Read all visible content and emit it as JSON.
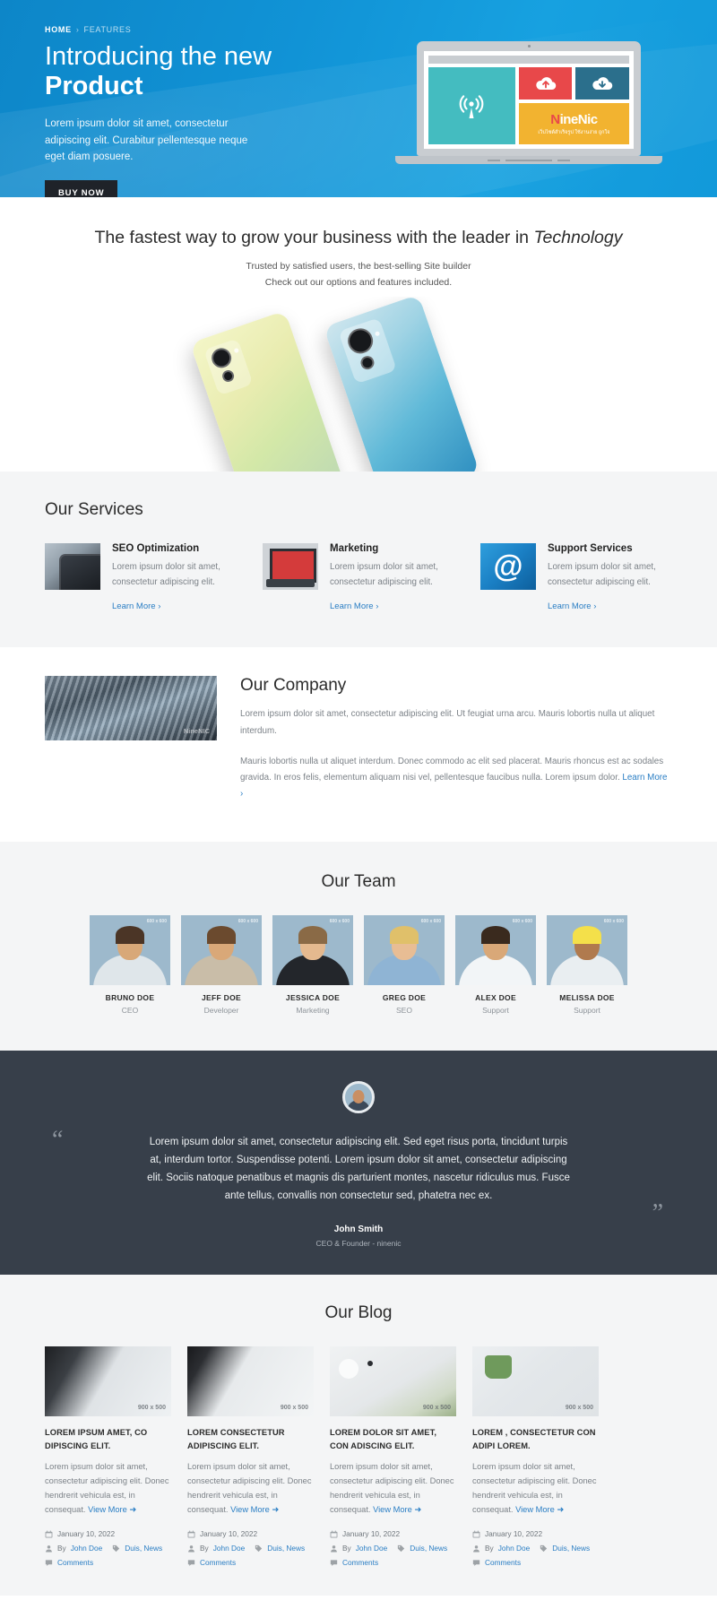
{
  "hero": {
    "breadcrumb": {
      "home": "HOME",
      "separator": "›",
      "current": "FEATURES"
    },
    "title_line1": "Introducing the new",
    "title_line2": "Product",
    "lead": "Lorem ipsum dolor sit amet, consectetur adipiscing elit. Curabitur pellentesque neque eget diam posuere.",
    "cta_label": "BUY NOW",
    "laptop": {
      "logo_prefix": "N",
      "logo_rest": "ineNic",
      "tagline": "เว็บไซต์สำเร็จรูป ใช้งานง่าย ถูกใจ",
      "wifi_icon": "broadcast-icon",
      "upload_icon": "cloud-upload-icon",
      "download_icon": "cloud-download-icon"
    },
    "colors": {
      "bg_start": "#0d86c8",
      "bg_end": "#1299da",
      "cta_bg": "#1f2329"
    }
  },
  "feature": {
    "heading_plain": "The fastest way to grow your business with the leader in ",
    "heading_em": "Technology",
    "sub_line1": "Trusted by satisfied users, the best-selling Site builder",
    "sub_line2": "Check out our options and features included."
  },
  "services": {
    "title": "Our Services",
    "items": [
      {
        "name": "SEO Optimization",
        "desc": "Lorem ipsum dolor sit amet, consectetur adipiscing elit.",
        "link": "Learn More ›",
        "thumb": "smartphone-apps-image"
      },
      {
        "name": "Marketing",
        "desc": "Lorem ipsum dolor sit amet, consectetur adipiscing elit.",
        "link": "Learn More ›",
        "thumb": "laptop-chart-image"
      },
      {
        "name": "Support Services",
        "desc": "Lorem ipsum dolor sit amet, consectetur adipiscing elit.",
        "link": "Learn More ›",
        "thumb": "at-sign-image"
      }
    ]
  },
  "company": {
    "title": "Our Company",
    "image_watermark": "NineNIC",
    "paragraph1": "Lorem ipsum dolor sit amet, consectetur adipiscing elit. Ut feugiat urna arcu. Mauris lobortis nulla ut aliquet interdum.",
    "paragraph2": "Mauris lobortis nulla ut aliquet interdum. Donec commodo ac elit sed placerat. Mauris rhoncus est ac sodales gravida. In eros felis, elementum aliquam nisi vel, pellentesque faucibus nulla. Lorem ipsum dolor. ",
    "link": "Learn More ›"
  },
  "team": {
    "title": "Our Team",
    "members": [
      {
        "name": "BRUNO DOE",
        "role": "CEO",
        "skin": "#d8a878",
        "hair": "#4b3526",
        "body": "#dfe6ea",
        "tag": "600 x 600"
      },
      {
        "name": "JEFF DOE",
        "role": "Developer",
        "skin": "#d9a878",
        "hair": "#6b4a2e",
        "body": "#c9bda8",
        "tag": "600 x 600"
      },
      {
        "name": "JESSICA DOE",
        "role": "Marketing",
        "skin": "#e4b98f",
        "hair": "#8a6a46",
        "body": "#23262b",
        "tag": "600 x 600"
      },
      {
        "name": "GREG DOE",
        "role": "SEO",
        "skin": "#e8bd94",
        "hair": "#e0c06a",
        "body": "#8fb4d4",
        "tag": "600 x 600"
      },
      {
        "name": "ALEX DOE",
        "role": "Support",
        "skin": "#d9a878",
        "hair": "#3a2a1e",
        "body": "#f2f5f7",
        "tag": "600 x 600"
      },
      {
        "name": "MELISSA DOE",
        "role": "Support",
        "skin": "#b07a4e",
        "hair": "#2a1c14",
        "body": "#f4e04a",
        "tag": "600 x 600"
      }
    ]
  },
  "testimonial": {
    "quote": "Lorem ipsum dolor sit amet, consectetur adipiscing elit. Sed eget risus porta, tincidunt turpis at, interdum tortor. Suspendisse potenti. Lorem ipsum dolor sit amet, consectetur adipiscing elit. Sociis natoque penatibus et magnis dis parturient montes, nascetur ridiculus mus. Fusce ante tellus, convallis non consectetur sed, phatetra nec ex.",
    "quote_open": "“",
    "quote_close": "”",
    "author": "John Smith",
    "author_role": "CEO & Founder - ninenic"
  },
  "blog": {
    "title": "Our Blog",
    "posts": [
      {
        "title": "LOREM IPSUM AMET, CO DIPISCING ELIT.",
        "excerpt": "Lorem ipsum dolor sit amet, consectetur adipiscing elit. Donec hendrerit vehicula est, in consequat. ",
        "read_more": "View More ➜",
        "date": "January 10, 2022",
        "author_prefix": "By ",
        "author": "John Doe",
        "tags": "Duis, News",
        "comments": "Comments",
        "image_dims": "900 x 500"
      },
      {
        "title": "LOREM CONSECTETUR ADIPISCING ELIT.",
        "excerpt": "Lorem ipsum dolor sit amet, consectetur adipiscing elit. Donec hendrerit vehicula est, in consequat. ",
        "read_more": "View More ➜",
        "date": "January 10, 2022",
        "author_prefix": "By ",
        "author": "John Doe",
        "tags": "Duis, News",
        "comments": "Comments",
        "image_dims": "900 x 500"
      },
      {
        "title": "LOREM DOLOR SIT AMET, CON ADISCING ELIT.",
        "excerpt": "Lorem ipsum dolor sit amet, consectetur adipiscing elit. Donec hendrerit vehicula est, in consequat. ",
        "read_more": "View More ➜",
        "date": "January 10, 2022",
        "author_prefix": "By ",
        "author": "John Doe",
        "tags": "Duis, News",
        "comments": "Comments",
        "image_dims": "900 x 500"
      },
      {
        "title": "LOREM , CONSECTETUR CON ADIPI LOREM.",
        "excerpt": "Lorem ipsum dolor sit amet, consectetur adipiscing elit. Donec hendrerit vehicula est, in consequat. ",
        "read_more": "View More ➜",
        "date": "January 10, 2022",
        "author_prefix": "By ",
        "author": "John Doe",
        "tags": "Duis, News",
        "comments": "Comments",
        "image_dims": "900 x 500"
      }
    ],
    "icons": {
      "date": "calendar-icon",
      "author": "user-icon",
      "tag": "tag-icon",
      "comment": "comment-icon"
    }
  }
}
